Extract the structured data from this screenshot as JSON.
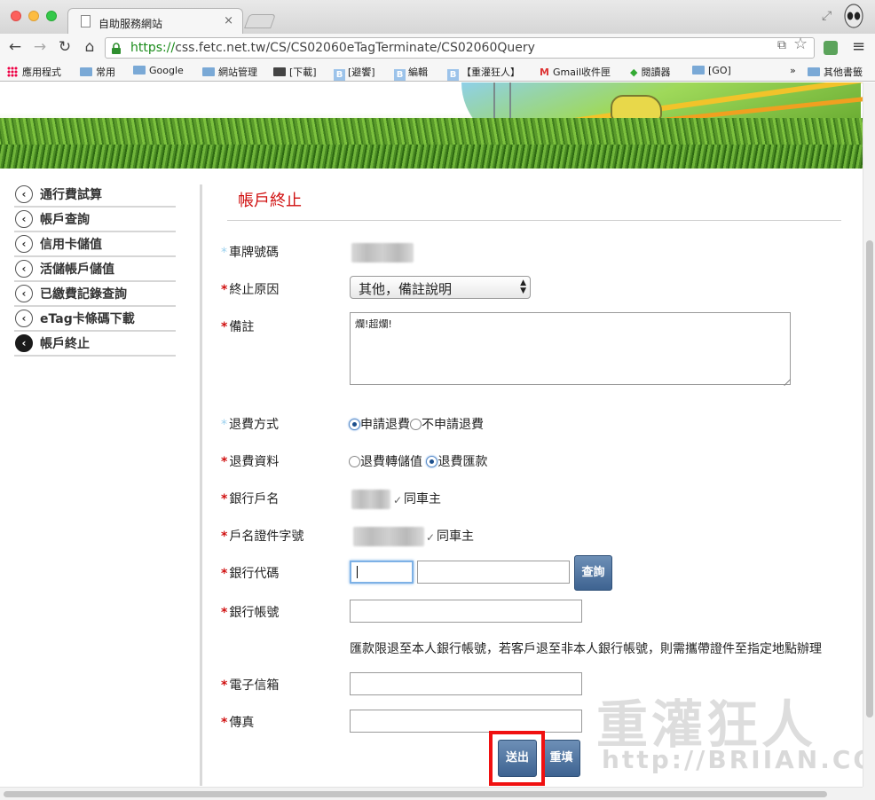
{
  "browser": {
    "tab_title": "自助服務網站",
    "tab_close": "×",
    "url_scheme": "https://",
    "url_rest": "css.fetc.net.tw/CS/CS02060eTagTerminate/CS02060Query",
    "icons": [
      "back-icon",
      "forward-icon",
      "reload-icon",
      "home-icon",
      "lock-icon",
      "star-icon",
      "menu-icon"
    ]
  },
  "bookmarks": {
    "apps": "應用程式",
    "items": [
      "常用",
      "Google",
      "網站管理",
      "[下載]",
      "[避饗]",
      "編輯",
      "【重灌狂人】",
      "Gmail收件匣",
      "閱讀器",
      "[GO]"
    ],
    "more": "»",
    "other": "其他書籤"
  },
  "sidebar": {
    "items": [
      {
        "label": "通行費試算",
        "active": false
      },
      {
        "label": "帳戶查詢",
        "active": false
      },
      {
        "label": "信用卡儲值",
        "active": false
      },
      {
        "label": "活儲帳戶儲值",
        "active": false
      },
      {
        "label": "已繳費記錄查詢",
        "active": false
      },
      {
        "label": "eTag卡條碼下載",
        "active": false
      },
      {
        "label": "帳戶終止",
        "active": true
      }
    ]
  },
  "form": {
    "title": "帳戶終止",
    "plate_label": "車牌號碼",
    "reason_label": "終止原因",
    "reason_value": "其他，備註說明",
    "memo_label": "備註",
    "memo_value": "爛!超爛!",
    "refund_method_label": "退費方式",
    "refund_method_options": [
      "申請退費",
      "不申請退費"
    ],
    "refund_method_selected": 0,
    "refund_data_label": "退費資料",
    "refund_data_options": [
      "退費轉儲值",
      "退費匯款"
    ],
    "refund_data_selected": 1,
    "bank_name_label": "銀行戶名",
    "same_owner_1": "同車主",
    "id_label": "戶名證件字號",
    "same_owner_2": "同車主",
    "bank_code_label": "銀行代碼",
    "query_button": "查詢",
    "account_label": "銀行帳號",
    "note": "匯款限退至本人銀行帳號，若客戶退至非本人銀行帳號，則需攜帶證件至指定地點辦理",
    "email_label": "電子信箱",
    "fax_label": "傳真",
    "submit_button": "送出",
    "reset_button": "重填",
    "required_mark": "*"
  },
  "watermark": {
    "line1": "重灌狂人",
    "line2": "http://BRIIAN.COM"
  }
}
